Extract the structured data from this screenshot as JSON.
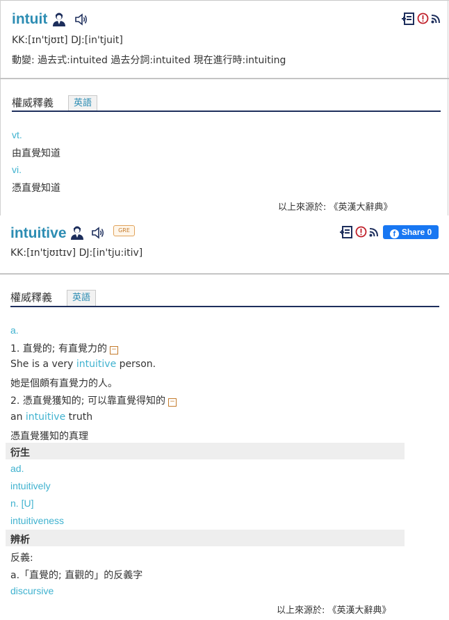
{
  "entry1": {
    "word": "intuit",
    "pronunciation": "KK:[ɪn'tjʊɪt] DJ:[in'tjuit]",
    "inflections": "動變: 過去式:intuited  過去分詞:intuited  現在進行時:intuiting",
    "section_title": "權威釋義",
    "tab_label": "英語",
    "senses": [
      {
        "pos": "vt.",
        "def": "由直覺知道"
      },
      {
        "pos": "vi.",
        "def": "憑直覺知道"
      }
    ],
    "source": "以上來源於: 《英漢大辭典》",
    "icons": [
      "expert-icon",
      "speaker-icon",
      "wordbook-icon",
      "report-icon",
      "rss-icon"
    ]
  },
  "entry2": {
    "word": "intuitive",
    "badge": "GRE",
    "pronunciation": "KK:[ɪn'tjʊɪtɪv] DJ:[in'tju:itiv]",
    "share_label": "Share 0",
    "section_title": "權威釋義",
    "tab_label": "英語",
    "pos": "a.",
    "sense1": "1. 直覺的; 有直覺力的",
    "ex1_pre": "She is a very ",
    "ex1_kw": "intuitive",
    "ex1_post": " person.",
    "ex1_zh": "她是個頗有直覺力的人。",
    "sense2": "2. 憑直覺獲知的; 可以靠直覺得知的",
    "ex2_pre": "an ",
    "ex2_kw": "intuitive",
    "ex2_post": " truth",
    "ex2_zh": "憑直覺獲知的真理",
    "derived_label": "衍生",
    "derived": [
      {
        "pos": "ad.",
        "word": "intuitively"
      },
      {
        "pos": "n. [U]",
        "word": "intuitiveness"
      }
    ],
    "analysis_label": "辨析",
    "antonym_label": "反義:",
    "antonym_desc": "a.「直覺的; 直觀的」的反義字",
    "antonym_word": "discursive",
    "source": "以上來源於: 《英漢大辭典》",
    "collapse_glyph": "−",
    "icons": [
      "expert-icon",
      "speaker-icon",
      "wordbook-icon",
      "report-icon",
      "rss-icon",
      "facebook-icon"
    ]
  }
}
